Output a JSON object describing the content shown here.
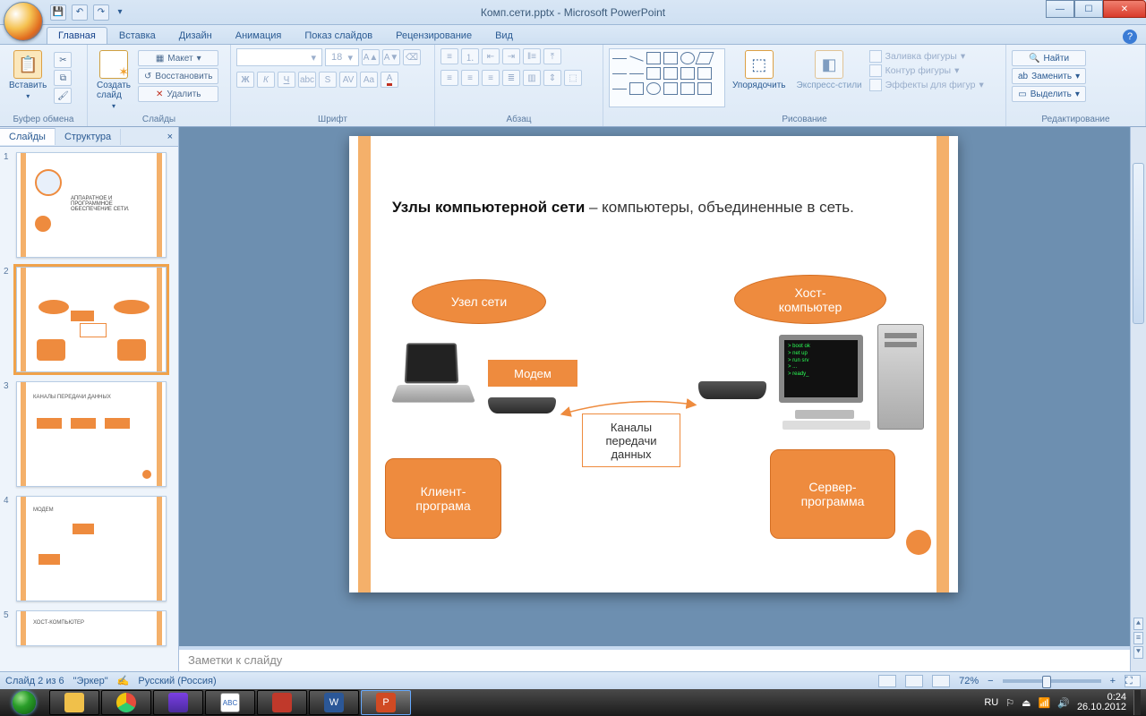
{
  "window": {
    "title": "Комп.сети.pptx - Microsoft PowerPoint"
  },
  "ribbon": {
    "tabs": [
      "Главная",
      "Вставка",
      "Дизайн",
      "Анимация",
      "Показ слайдов",
      "Рецензирование",
      "Вид"
    ],
    "active_tab": "Главная",
    "groups": {
      "clipboard": {
        "label": "Буфер обмена",
        "paste": "Вставить"
      },
      "slides": {
        "label": "Слайды",
        "new": "Создать\nслайд",
        "layout": "Макет",
        "reset": "Восстановить",
        "delete": "Удалить"
      },
      "font": {
        "label": "Шрифт",
        "size": "18"
      },
      "para": {
        "label": "Абзац"
      },
      "drawing": {
        "label": "Рисование",
        "arrange": "Упорядочить",
        "quick": "Экспресс-стили",
        "fill": "Заливка фигуры",
        "outline": "Контур фигуры",
        "effects": "Эффекты для фигур"
      },
      "editing": {
        "label": "Редактирование",
        "find": "Найти",
        "replace": "Заменить",
        "select": "Выделить"
      }
    }
  },
  "sidepane": {
    "tabs": {
      "slides": "Слайды",
      "outline": "Структура"
    },
    "thumbs": [
      "1",
      "2",
      "3",
      "4",
      "5"
    ],
    "thumb1_title": "АППАРАТНОЕ И ПРОГРАММНОЕ\nОБЕСПЕЧЕНИЕ СЕТИ.",
    "thumb3_title": "КАНАЛЫ ПЕРЕДАЧИ ДАННЫХ",
    "thumb4_title": "МОДЕМ",
    "thumb5_title": "ХОСТ-КОМПЬЮТЕР"
  },
  "slide": {
    "heading_bold": "Узлы компьютерной сети",
    "heading_rest": " – компьютеры, объединенные в сеть.",
    "node": "Узел сети",
    "host": "Хост-\nкомпьютер",
    "modem": "Модем",
    "channels": "Каналы\nпередачи\nданных",
    "client": "Клиент-\nпрограма",
    "server": "Сервер-\nпрограмма"
  },
  "notes": {
    "placeholder": "Заметки к слайду"
  },
  "status": {
    "slide": "Слайд 2 из 6",
    "theme": "\"Эркер\"",
    "lang": "Русский (Россия)",
    "zoom": "72%"
  },
  "taskbar": {
    "lang": "RU",
    "time": "0:24",
    "date": "26.10.2012"
  }
}
